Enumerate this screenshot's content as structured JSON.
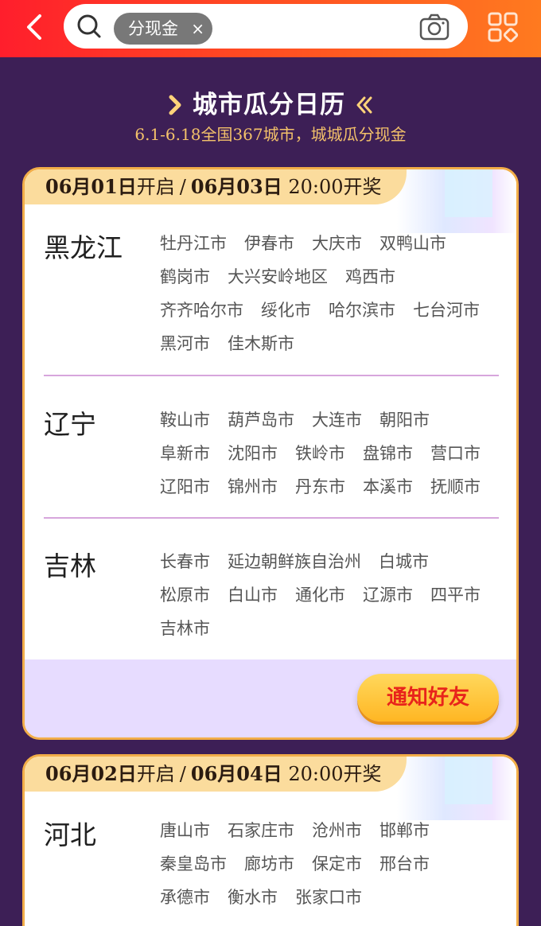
{
  "search": {
    "tag": "分现金",
    "tag_close": "×"
  },
  "calendar": {
    "title": "城市瓜分日历",
    "subtitle": "6.1-6.18全国367城市，城城瓜分现金"
  },
  "cards": [
    {
      "start_date": "06月01日",
      "start_label": "开启",
      "separator": "/",
      "draw_date": "06月03日",
      "draw_time": "20:00开奖",
      "regions": [
        {
          "province": "黑龙江",
          "cities": [
            "牡丹江市",
            "伊春市",
            "大庆市",
            "双鸭山市",
            "鹤岗市",
            "大兴安岭地区",
            "鸡西市",
            "齐齐哈尔市",
            "绥化市",
            "哈尔滨市",
            "七台河市",
            "黑河市",
            "佳木斯市"
          ]
        },
        {
          "province": "辽宁",
          "cities": [
            "鞍山市",
            "葫芦岛市",
            "大连市",
            "朝阳市",
            "阜新市",
            "沈阳市",
            "铁岭市",
            "盘锦市",
            "营口市",
            "辽阳市",
            "锦州市",
            "丹东市",
            "本溪市",
            "抚顺市"
          ]
        },
        {
          "province": "吉林",
          "cities": [
            "长春市",
            "延边朝鲜族自治州",
            "白城市",
            "松原市",
            "白山市",
            "通化市",
            "辽源市",
            "四平市",
            "吉林市"
          ]
        }
      ],
      "notify_label": "通知好友"
    },
    {
      "start_date": "06月02日",
      "start_label": "开启",
      "separator": "/",
      "draw_date": "06月04日",
      "draw_time": "20:00开奖",
      "regions": [
        {
          "province": "河北",
          "cities": [
            "唐山市",
            "石家庄市",
            "沧州市",
            "邯郸市",
            "秦皇岛市",
            "廊坊市",
            "保定市",
            "邢台市",
            "承德市",
            "衡水市",
            "张家口市"
          ]
        }
      ]
    }
  ],
  "colors": {
    "topbar_start": "#ff1e2c",
    "topbar_end": "#ff7a1f",
    "page_bg": "#3d1f56",
    "card_border": "#f2ad48",
    "notify_text": "#e8241b"
  },
  "icons": {
    "back": "chevron-left-icon",
    "search": "search-icon",
    "camera": "camera-icon",
    "menu": "grid-menu-icon"
  }
}
